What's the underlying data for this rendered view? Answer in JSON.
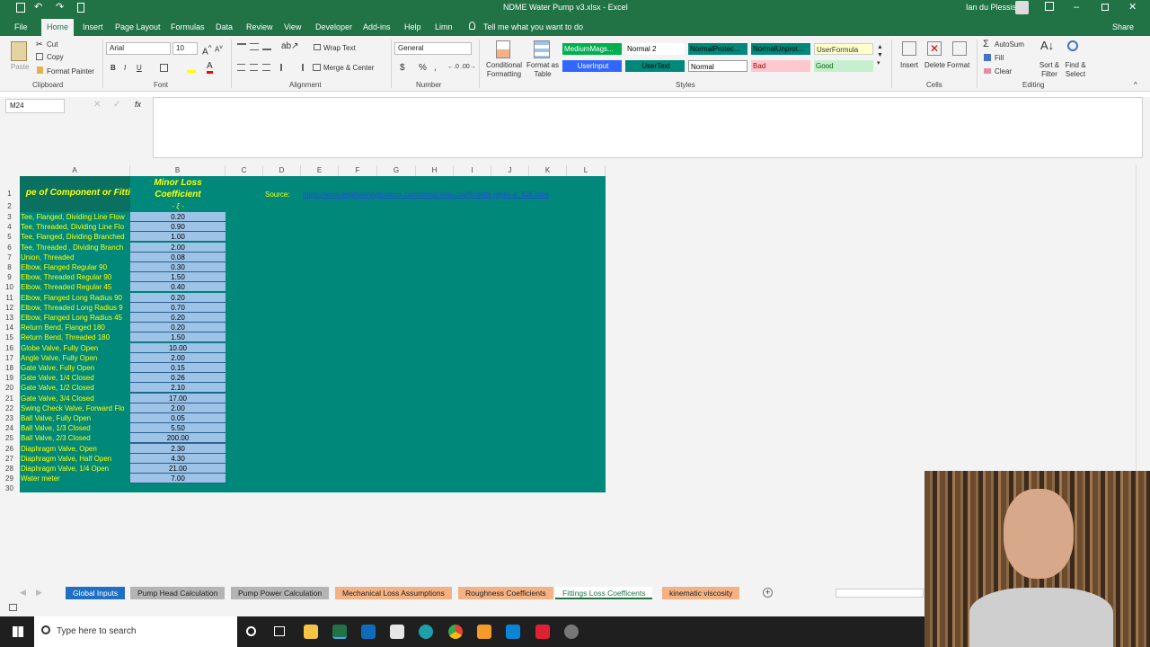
{
  "titlebar": {
    "doc_title": "NDME Water Pump v3.xlsx - Excel",
    "user": "Ian du Plessis"
  },
  "ribbon_tabs": [
    "File",
    "Home",
    "Insert",
    "Page Layout",
    "Formulas",
    "Data",
    "Review",
    "View",
    "Developer",
    "Add-ins",
    "Help",
    "Limn"
  ],
  "tell_me": "Tell me what you want to do",
  "share": "Share",
  "clipboard": {
    "paste": "Paste",
    "cut": "Cut",
    "copy": "Copy",
    "format_painter": "Format Painter",
    "label": "Clipboard"
  },
  "font": {
    "name": "Arial",
    "size": "10",
    "bold": "B",
    "italic": "I",
    "underline": "U",
    "label": "Font"
  },
  "alignment": {
    "wrap": "Wrap Text",
    "merge": "Merge & Center",
    "label": "Alignment"
  },
  "number": {
    "format": "General",
    "currency": "$",
    "percent": "%",
    "comma": ",",
    "label": "Number"
  },
  "styles": {
    "conditional": "Conditional Formatting",
    "format_table": "Format as Table",
    "label": "Styles",
    "boxes": [
      {
        "text": "MediumMags...",
        "bg": "#00b050",
        "fg": "#ffffff"
      },
      {
        "text": "Normal 2",
        "bg": "#ffffff",
        "fg": "#000000"
      },
      {
        "text": "NormalProtec...",
        "bg": "#00897b",
        "fg": "#000000"
      },
      {
        "text": "NormalUnprot...",
        "bg": "#00897b",
        "fg": "#000000"
      },
      {
        "text": "UserFormula",
        "bg": "#ffffcc",
        "fg": "#333333"
      },
      {
        "text": "UserInput",
        "bg": "#3366ff",
        "fg": "#ffffff"
      },
      {
        "text": "UserText",
        "bg": "#00897b",
        "fg": "#000000"
      },
      {
        "text": "Normal",
        "bg": "#ffffff",
        "fg": "#000000"
      },
      {
        "text": "Bad",
        "bg": "#ffc7ce",
        "fg": "#9c0006"
      },
      {
        "text": "Good",
        "bg": "#c6efce",
        "fg": "#006100"
      }
    ]
  },
  "cells_group": {
    "insert": "Insert",
    "delete": "Delete",
    "format": "Format",
    "label": "Cells"
  },
  "editing": {
    "autosum": "AutoSum",
    "fill": "Fill",
    "clear": "Clear",
    "sort": "Sort & Filter",
    "find": "Find & Select",
    "label": "Editing"
  },
  "namebox": "M24",
  "fx": "fx",
  "columns": [
    "A",
    "B",
    "C",
    "D",
    "E",
    "F",
    "G",
    "H",
    "I",
    "J",
    "K",
    "L"
  ],
  "header": {
    "a1": "pe of Component or Fitti",
    "b1_line1": "Minor Loss",
    "b1_line2": "Coefficient",
    "b2": "- ξ -"
  },
  "source": {
    "label": "Source:",
    "link": "https://www.engineeringtoolbox.com/minor-loss-coefficients-pipes-d_626.html"
  },
  "rows": [
    {
      "n": "3",
      "a": "Tee, Flanged, Dividing Line Flow",
      "b": "0.20"
    },
    {
      "n": "4",
      "a": "Tee, Threaded, Dividing Line Flo",
      "b": "0.90"
    },
    {
      "n": "5",
      "a": "Tee, Flanged, Dividing Branched",
      "b": "1.00"
    },
    {
      "n": "6",
      "a": "Tee, Threaded , Dividing Branch",
      "b": "2.00"
    },
    {
      "n": "7",
      "a": "Union, Threaded",
      "b": "0.08"
    },
    {
      "n": "8",
      "a": "Elbow, Flanged Regular 90",
      "b": "0.30"
    },
    {
      "n": "9",
      "a": "Elbow, Threaded Regular 90",
      "b": "1.50"
    },
    {
      "n": "10",
      "a": "Elbow, Threaded Regular 45",
      "b": "0.40"
    },
    {
      "n": "11",
      "a": "Elbow, Flanged Long Radius 90",
      "b": "0.20"
    },
    {
      "n": "12",
      "a": "Elbow, Threaded Long Radius 9",
      "b": "0.70"
    },
    {
      "n": "13",
      "a": "Elbow, Flanged Long Radius 45",
      "b": "0.20"
    },
    {
      "n": "14",
      "a": "Return Bend, Flanged 180",
      "b": "0.20"
    },
    {
      "n": "15",
      "a": "Return Bend, Threaded 180",
      "b": "1.50"
    },
    {
      "n": "16",
      "a": "Globe Valve, Fully Open",
      "b": "10.00"
    },
    {
      "n": "17",
      "a": "Angle Valve, Fully Open",
      "b": "2.00"
    },
    {
      "n": "18",
      "a": "Gate Valve, Fully Open",
      "b": "0.15"
    },
    {
      "n": "19",
      "a": "Gate Valve, 1/4 Closed",
      "b": "0.26"
    },
    {
      "n": "20",
      "a": "Gate Valve, 1/2 Closed",
      "b": "2.10"
    },
    {
      "n": "21",
      "a": "Gate Valve, 3/4 Closed",
      "b": "17.00"
    },
    {
      "n": "22",
      "a": "Swing Check Valve, Forward Flo",
      "b": "2.00"
    },
    {
      "n": "23",
      "a": "Ball Valve, Fully Open",
      "b": "0.05"
    },
    {
      "n": "24",
      "a": "Ball Valve, 1/3 Closed",
      "b": "5.50"
    },
    {
      "n": "25",
      "a": "Ball Valve, 2/3 Closed",
      "b": "200.00"
    },
    {
      "n": "26",
      "a": "Diaphragm Valve, Open",
      "b": "2.30"
    },
    {
      "n": "27",
      "a": "Diaphragm Valve, Half Open",
      "b": "4.30"
    },
    {
      "n": "28",
      "a": "Diaphragm Valve, 1/4 Open",
      "b": "21.00"
    },
    {
      "n": "29",
      "a": "Water meter",
      "b": "7.00"
    }
  ],
  "row_labels_top": [
    "1",
    "2"
  ],
  "row_label_last": "30",
  "sheet_tabs": [
    {
      "label": "Global Inputs",
      "bg": "#1f6fc5",
      "fg": "#ffffff"
    },
    {
      "label": "Pump Head Calculation",
      "bg": "#b4b4b4",
      "fg": "#222222"
    },
    {
      "label": "Pump Power Calculation",
      "bg": "#b4b4b4",
      "fg": "#222222"
    },
    {
      "label": "Mechanical Loss Assumptions",
      "bg": "#f4b183",
      "fg": "#222222"
    },
    {
      "label": "Roughness Coefficients",
      "bg": "#f4b183",
      "fg": "#222222"
    },
    {
      "label": "Fittings Loss Coefficents",
      "bg": "#ffffff",
      "fg": "#217346"
    },
    {
      "label": "kinematic viscosity",
      "bg": "#f4b183",
      "fg": "#222222"
    }
  ],
  "taskbar": {
    "search": "Type here to search"
  }
}
